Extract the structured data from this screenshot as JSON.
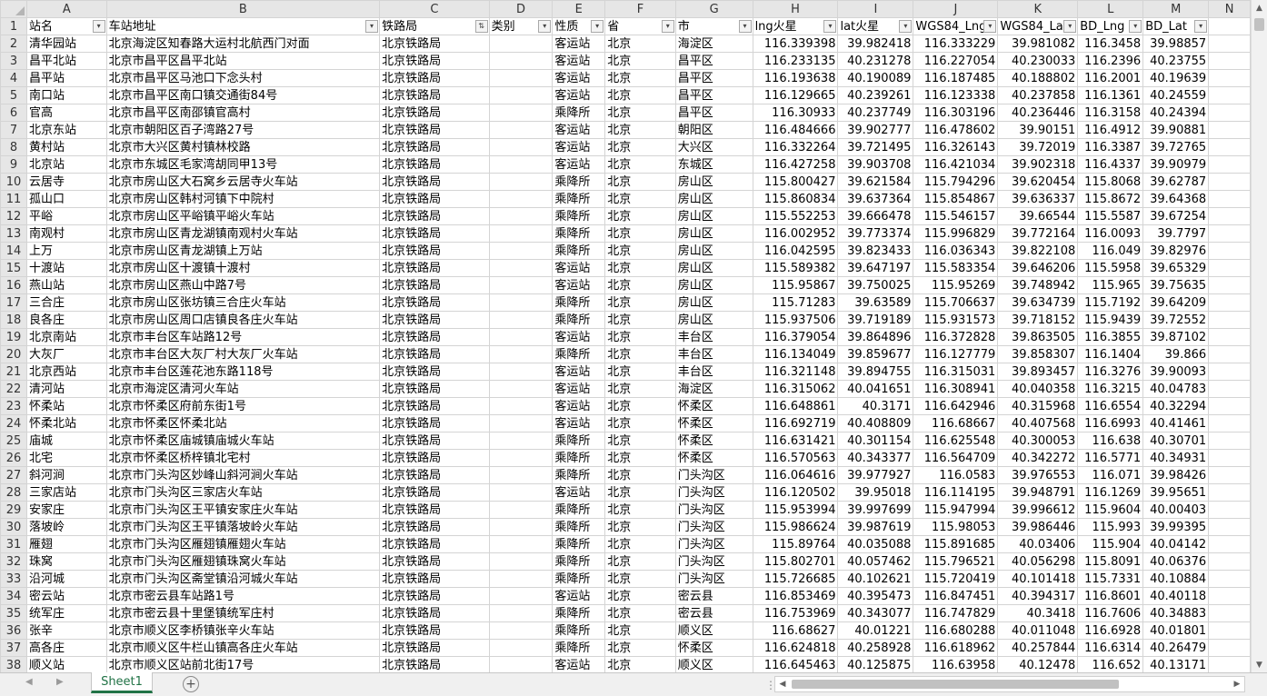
{
  "columns": [
    "A",
    "B",
    "C",
    "D",
    "E",
    "F",
    "G",
    "H",
    "I",
    "J",
    "K",
    "L",
    "M",
    "N"
  ],
  "header_row_number": "1",
  "headers": [
    {
      "label": "站名",
      "filter": "▾"
    },
    {
      "label": "车站地址",
      "filter": "▾"
    },
    {
      "label": "铁路局",
      "filter": "⇅"
    },
    {
      "label": "类别",
      "filter": "▾"
    },
    {
      "label": "性质",
      "filter": "▾"
    },
    {
      "label": "省",
      "filter": "▾"
    },
    {
      "label": "市",
      "filter": "▾"
    },
    {
      "label": "lng火星",
      "filter": "▾"
    },
    {
      "label": "lat火星",
      "filter": "▾"
    },
    {
      "label": "WGS84_Lng",
      "filter": "▾"
    },
    {
      "label": "WGS84_Lat",
      "filter": "▾"
    },
    {
      "label": "BD_Lng",
      "filter": "▾"
    },
    {
      "label": "BD_Lat",
      "filter": "▾"
    }
  ],
  "rows": [
    {
      "n": "2",
      "cells": [
        "清华园站",
        "北京海淀区知春路大运村北航西门对面",
        "北京铁路局",
        "",
        "客运站",
        "北京",
        "海淀区",
        "116.339398",
        "39.982418",
        "116.333229",
        "39.981082",
        "116.3458",
        "39.98857"
      ]
    },
    {
      "n": "3",
      "cells": [
        "昌平北站",
        "北京市昌平区昌平北站",
        "北京铁路局",
        "",
        "客运站",
        "北京",
        "昌平区",
        "116.233135",
        "40.231278",
        "116.227054",
        "40.230033",
        "116.2396",
        "40.23755"
      ]
    },
    {
      "n": "4",
      "cells": [
        "昌平站",
        "北京市昌平区马池口下念头村",
        "北京铁路局",
        "",
        "客运站",
        "北京",
        "昌平区",
        "116.193638",
        "40.190089",
        "116.187485",
        "40.188802",
        "116.2001",
        "40.19639"
      ]
    },
    {
      "n": "5",
      "cells": [
        "南口站",
        "北京市昌平区南口镇交通街84号",
        "北京铁路局",
        "",
        "客运站",
        "北京",
        "昌平区",
        "116.129665",
        "40.239261",
        "116.123338",
        "40.237858",
        "116.1361",
        "40.24559"
      ]
    },
    {
      "n": "6",
      "cells": [
        "官高",
        "北京市昌平区南邵镇官高村",
        "北京铁路局",
        "",
        "乘降所",
        "北京",
        "昌平区",
        "116.30933",
        "40.237749",
        "116.303196",
        "40.236446",
        "116.3158",
        "40.24394"
      ]
    },
    {
      "n": "7",
      "cells": [
        "北京东站",
        "北京市朝阳区百子湾路27号",
        "北京铁路局",
        "",
        "客运站",
        "北京",
        "朝阳区",
        "116.484666",
        "39.902777",
        "116.478602",
        "39.90151",
        "116.4912",
        "39.90881"
      ]
    },
    {
      "n": "8",
      "cells": [
        "黄村站",
        "北京市大兴区黄村镇林校路",
        "北京铁路局",
        "",
        "客运站",
        "北京",
        "大兴区",
        "116.332264",
        "39.721495",
        "116.326143",
        "39.72019",
        "116.3387",
        "39.72765"
      ]
    },
    {
      "n": "9",
      "cells": [
        "北京站",
        "北京市东城区毛家湾胡同甲13号",
        "北京铁路局",
        "",
        "客运站",
        "北京",
        "东城区",
        "116.427258",
        "39.903708",
        "116.421034",
        "39.902318",
        "116.4337",
        "39.90979"
      ]
    },
    {
      "n": "10",
      "cells": [
        "云居寺",
        "北京市房山区大石窝乡云居寺火车站",
        "北京铁路局",
        "",
        "乘降所",
        "北京",
        "房山区",
        "115.800427",
        "39.621584",
        "115.794296",
        "39.620454",
        "115.8068",
        "39.62787"
      ]
    },
    {
      "n": "11",
      "cells": [
        "孤山口",
        "北京市房山区韩村河镇下中院村",
        "北京铁路局",
        "",
        "乘降所",
        "北京",
        "房山区",
        "115.860834",
        "39.637364",
        "115.854867",
        "39.636337",
        "115.8672",
        "39.64368"
      ]
    },
    {
      "n": "12",
      "cells": [
        "平峪",
        "北京市房山区平峪镇平峪火车站",
        "北京铁路局",
        "",
        "乘降所",
        "北京",
        "房山区",
        "115.552253",
        "39.666478",
        "115.546157",
        "39.66544",
        "115.5587",
        "39.67254"
      ]
    },
    {
      "n": "13",
      "cells": [
        "南观村",
        "北京市房山区青龙湖镇南观村火车站",
        "北京铁路局",
        "",
        "乘降所",
        "北京",
        "房山区",
        "116.002952",
        "39.773374",
        "115.996829",
        "39.772164",
        "116.0093",
        "39.7797"
      ]
    },
    {
      "n": "14",
      "cells": [
        "上万",
        "北京市房山区青龙湖镇上万站",
        "北京铁路局",
        "",
        "乘降所",
        "北京",
        "房山区",
        "116.042595",
        "39.823433",
        "116.036343",
        "39.822108",
        "116.049",
        "39.82976"
      ]
    },
    {
      "n": "15",
      "cells": [
        "十渡站",
        "北京市房山区十渡镇十渡村",
        "北京铁路局",
        "",
        "客运站",
        "北京",
        "房山区",
        "115.589382",
        "39.647197",
        "115.583354",
        "39.646206",
        "115.5958",
        "39.65329"
      ]
    },
    {
      "n": "16",
      "cells": [
        "燕山站",
        "北京市房山区燕山中路7号",
        "北京铁路局",
        "",
        "客运站",
        "北京",
        "房山区",
        "115.95867",
        "39.750025",
        "115.95269",
        "39.748942",
        "115.965",
        "39.75635"
      ]
    },
    {
      "n": "17",
      "cells": [
        "三合庄",
        "北京市房山区张坊镇三合庄火车站",
        "北京铁路局",
        "",
        "乘降所",
        "北京",
        "房山区",
        "115.71283",
        "39.63589",
        "115.706637",
        "39.634739",
        "115.7192",
        "39.64209"
      ]
    },
    {
      "n": "18",
      "cells": [
        "良各庄",
        "北京市房山区周口店镇良各庄火车站",
        "北京铁路局",
        "",
        "乘降所",
        "北京",
        "房山区",
        "115.937506",
        "39.719189",
        "115.931573",
        "39.718152",
        "115.9439",
        "39.72552"
      ]
    },
    {
      "n": "19",
      "cells": [
        "北京南站",
        "北京市丰台区车站路12号",
        "北京铁路局",
        "",
        "客运站",
        "北京",
        "丰台区",
        "116.379054",
        "39.864896",
        "116.372828",
        "39.863505",
        "116.3855",
        "39.87102"
      ]
    },
    {
      "n": "20",
      "cells": [
        "大灰厂",
        "北京市丰台区大灰厂村大灰厂火车站",
        "北京铁路局",
        "",
        "乘降所",
        "北京",
        "丰台区",
        "116.134049",
        "39.859677",
        "116.127779",
        "39.858307",
        "116.1404",
        "39.866"
      ]
    },
    {
      "n": "21",
      "cells": [
        "北京西站",
        "北京市丰台区莲花池东路118号",
        "北京铁路局",
        "",
        "客运站",
        "北京",
        "丰台区",
        "116.321148",
        "39.894755",
        "116.315031",
        "39.893457",
        "116.3276",
        "39.90093"
      ]
    },
    {
      "n": "22",
      "cells": [
        "清河站",
        "北京市海淀区清河火车站",
        "北京铁路局",
        "",
        "客运站",
        "北京",
        "海淀区",
        "116.315062",
        "40.041651",
        "116.308941",
        "40.040358",
        "116.3215",
        "40.04783"
      ]
    },
    {
      "n": "23",
      "cells": [
        "怀柔站",
        "北京市怀柔区府前东街1号",
        "北京铁路局",
        "",
        "客运站",
        "北京",
        "怀柔区",
        "116.648861",
        "40.3171",
        "116.642946",
        "40.315968",
        "116.6554",
        "40.32294"
      ]
    },
    {
      "n": "24",
      "cells": [
        "怀柔北站",
        "北京市怀柔区怀柔北站",
        "北京铁路局",
        "",
        "客运站",
        "北京",
        "怀柔区",
        "116.692719",
        "40.408809",
        "116.68667",
        "40.407568",
        "116.6993",
        "40.41461"
      ]
    },
    {
      "n": "25",
      "cells": [
        "庙城",
        "北京市怀柔区庙城镇庙城火车站",
        "北京铁路局",
        "",
        "乘降所",
        "北京",
        "怀柔区",
        "116.631421",
        "40.301154",
        "116.625548",
        "40.300053",
        "116.638",
        "40.30701"
      ]
    },
    {
      "n": "26",
      "cells": [
        "北宅",
        "北京市怀柔区桥梓镇北宅村",
        "北京铁路局",
        "",
        "乘降所",
        "北京",
        "怀柔区",
        "116.570563",
        "40.343377",
        "116.564709",
        "40.342272",
        "116.5771",
        "40.34931"
      ]
    },
    {
      "n": "27",
      "cells": [
        "斜河涧",
        "北京市门头沟区妙峰山斜河涧火车站",
        "北京铁路局",
        "",
        "乘降所",
        "北京",
        "门头沟区",
        "116.064616",
        "39.977927",
        "116.0583",
        "39.976553",
        "116.071",
        "39.98426"
      ]
    },
    {
      "n": "28",
      "cells": [
        "三家店站",
        "北京市门头沟区三家店火车站",
        "北京铁路局",
        "",
        "客运站",
        "北京",
        "门头沟区",
        "116.120502",
        "39.95018",
        "116.114195",
        "39.948791",
        "116.1269",
        "39.95651"
      ]
    },
    {
      "n": "29",
      "cells": [
        "安家庄",
        "北京市门头沟区王平镇安家庄火车站",
        "北京铁路局",
        "",
        "乘降所",
        "北京",
        "门头沟区",
        "115.953994",
        "39.997699",
        "115.947994",
        "39.996612",
        "115.9604",
        "40.00403"
      ]
    },
    {
      "n": "30",
      "cells": [
        "落坡岭",
        "北京市门头沟区王平镇落坡岭火车站",
        "北京铁路局",
        "",
        "乘降所",
        "北京",
        "门头沟区",
        "115.986624",
        "39.987619",
        "115.98053",
        "39.986446",
        "115.993",
        "39.99395"
      ]
    },
    {
      "n": "31",
      "cells": [
        "雁翅",
        "北京市门头沟区雁翅镇雁翅火车站",
        "北京铁路局",
        "",
        "乘降所",
        "北京",
        "门头沟区",
        "115.89764",
        "40.035088",
        "115.891685",
        "40.03406",
        "115.904",
        "40.04142"
      ]
    },
    {
      "n": "32",
      "cells": [
        "珠窝",
        "北京市门头沟区雁翅镇珠窝火车站",
        "北京铁路局",
        "",
        "乘降所",
        "北京",
        "门头沟区",
        "115.802701",
        "40.057462",
        "115.796521",
        "40.056298",
        "115.8091",
        "40.06376"
      ]
    },
    {
      "n": "33",
      "cells": [
        "沿河城",
        "北京市门头沟区斋堂镇沿河城火车站",
        "北京铁路局",
        "",
        "乘降所",
        "北京",
        "门头沟区",
        "115.726685",
        "40.102621",
        "115.720419",
        "40.101418",
        "115.7331",
        "40.10884"
      ]
    },
    {
      "n": "34",
      "cells": [
        "密云站",
        "北京市密云县车站路1号",
        "北京铁路局",
        "",
        "客运站",
        "北京",
        "密云县",
        "116.853469",
        "40.395473",
        "116.847451",
        "40.394317",
        "116.8601",
        "40.40118"
      ]
    },
    {
      "n": "35",
      "cells": [
        "统军庄",
        "北京市密云县十里堡镇统军庄村",
        "北京铁路局",
        "",
        "乘降所",
        "北京",
        "密云县",
        "116.753969",
        "40.343077",
        "116.747829",
        "40.3418",
        "116.7606",
        "40.34883"
      ]
    },
    {
      "n": "36",
      "cells": [
        "张辛",
        "北京市顺义区李桥镇张辛火车站",
        "北京铁路局",
        "",
        "乘降所",
        "北京",
        "顺义区",
        "116.68627",
        "40.01221",
        "116.680288",
        "40.011048",
        "116.6928",
        "40.01801"
      ]
    },
    {
      "n": "37",
      "cells": [
        "高各庄",
        "北京市顺义区牛栏山镇高各庄火车站",
        "北京铁路局",
        "",
        "乘降所",
        "北京",
        "怀柔区",
        "116.624818",
        "40.258928",
        "116.618962",
        "40.257844",
        "116.6314",
        "40.26479"
      ]
    },
    {
      "n": "38",
      "cells": [
        "顺义站",
        "北京市顺义区站前北街17号",
        "北京铁路局",
        "",
        "客运站",
        "北京",
        "顺义区",
        "116.645463",
        "40.125875",
        "116.63958",
        "40.12478",
        "116.652",
        "40.13171"
      ]
    }
  ],
  "sheet_tab": "Sheet1",
  "add_sheet_glyph": "+",
  "icons": {
    "scroll_up": "▲",
    "scroll_down": "▼",
    "scroll_left": "◀",
    "scroll_right": "▶",
    "nav_prev": "◀",
    "nav_next": "▶",
    "tab_split": "⋮"
  },
  "colors": {
    "sheet_tab_accent": "#217346",
    "header_bg": "#e6e6e6",
    "gridline": "#d4d4d4"
  }
}
